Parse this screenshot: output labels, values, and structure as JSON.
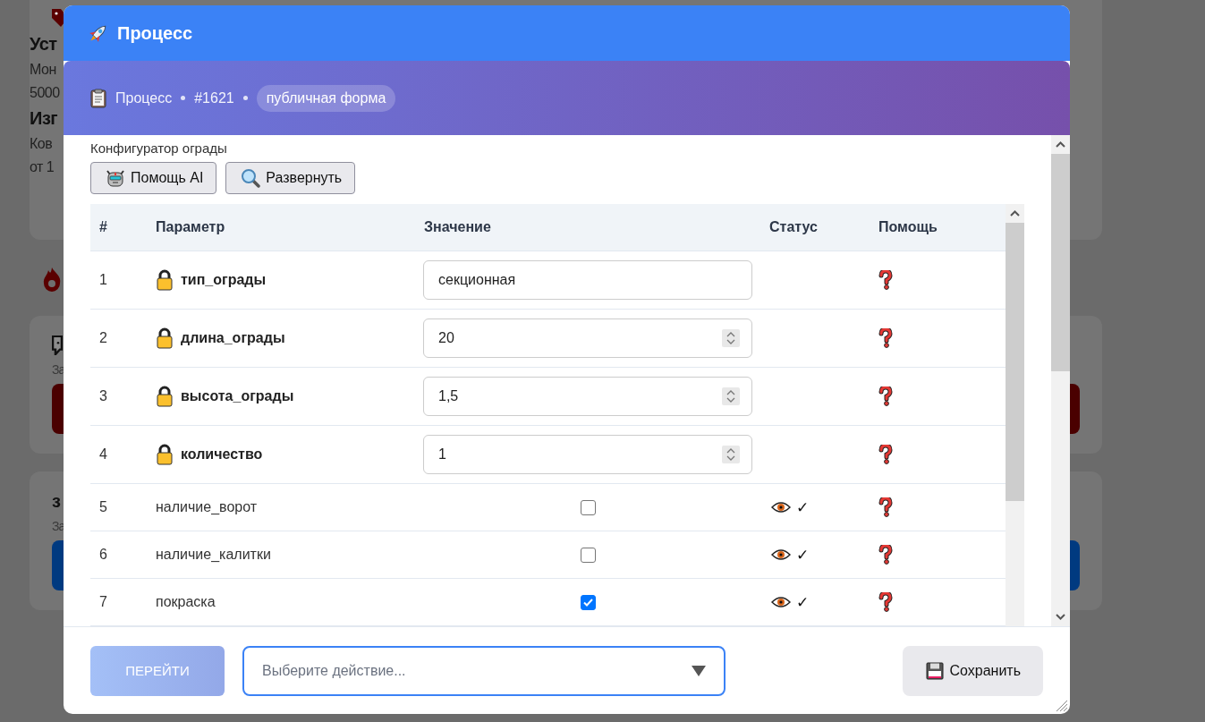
{
  "background": {
    "sections": [
      {
        "kind": "card",
        "lines": [
          {
            "kind": "tag"
          },
          {
            "kind": "heading",
            "text": "Уст"
          },
          {
            "kind": "text",
            "text": "Мон"
          },
          {
            "kind": "text",
            "text": "5000"
          },
          {
            "kind": "heading",
            "text": "Изг"
          },
          {
            "kind": "text",
            "text": "Ков"
          },
          {
            "kind": "text",
            "text": "от 1"
          }
        ]
      },
      {
        "kind": "flame"
      },
      {
        "kind": "card",
        "lines": [
          {
            "kind": "chat"
          },
          {
            "kind": "text",
            "text": "За"
          },
          {
            "kind": "button",
            "color": "#4a0000"
          }
        ]
      },
      {
        "kind": "card",
        "lines": [
          {
            "kind": "heading",
            "text": "з"
          },
          {
            "kind": "text",
            "text": "За"
          },
          {
            "kind": "button",
            "color": "#003a80"
          }
        ]
      }
    ]
  },
  "dialog": {
    "title": "Процесс",
    "breadcrumb": {
      "process": "Процесс",
      "number": "#1621",
      "badge": "публичная форма"
    },
    "section_title": "Конфигуратор ограды",
    "tools": [
      {
        "kind": "robot",
        "label": "Помощь AI"
      },
      {
        "kind": "search",
        "label": "Развернуть"
      }
    ],
    "table": {
      "columns": [
        "#",
        "Параметр",
        "Значение",
        "Статус",
        "Помощь"
      ],
      "rows": [
        {
          "number": "1",
          "name": "тип_ограды",
          "locked": true,
          "kind": "text",
          "value": "секционная",
          "visible": false
        },
        {
          "number": "2",
          "name": "длина_ограды",
          "locked": true,
          "kind": "number",
          "value": "20",
          "visible": false
        },
        {
          "number": "3",
          "name": "высота_ограды",
          "locked": true,
          "kind": "number",
          "value": "1,5",
          "visible": false
        },
        {
          "number": "4",
          "name": "количество",
          "locked": true,
          "kind": "number",
          "value": "1",
          "visible": false
        },
        {
          "number": "5",
          "name": "наличие_ворот",
          "locked": false,
          "kind": "checkbox",
          "checked": false,
          "visible": true,
          "status": "✓"
        },
        {
          "number": "6",
          "name": "наличие_калитки",
          "locked": false,
          "kind": "checkbox",
          "checked": false,
          "visible": true,
          "status": "✓"
        },
        {
          "number": "7",
          "name": "покраска",
          "locked": false,
          "kind": "checkbox",
          "checked": true,
          "visible": true,
          "status": "✓"
        }
      ]
    },
    "footer": {
      "go_button": {
        "label": "ПЕРЕЙТИ",
        "disabled": true
      },
      "action_select": {
        "placeholder": "Выберите действие..."
      },
      "save_button": {
        "label": "Сохранить"
      }
    }
  }
}
